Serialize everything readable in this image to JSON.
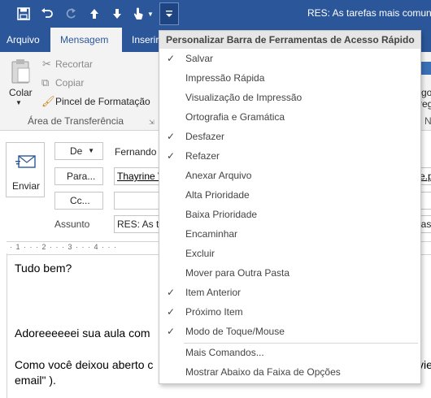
{
  "window": {
    "title": "RES: As tarefas mais comuns,"
  },
  "tabs": [
    "Arquivo",
    "Mensagem",
    "Inserir"
  ],
  "ribbon": {
    "paste_label": "Colar",
    "cut_label": "Recortar",
    "copy_label": "Copiar",
    "format_painter_label": "Pincel de Formatação",
    "clipboard_group_label": "Área de Transferência",
    "right_partial_1": "go",
    "right_partial_2": "reg",
    "right_partial_3": "N"
  },
  "compose": {
    "send_label": "Enviar",
    "from_button": "De",
    "from_value": "Fernando",
    "to_button": "Para...",
    "to_value": "Thayrine V",
    "to_value_right": "e.p",
    "cc_button": "Cc...",
    "subject_label": "Assunto",
    "subject_value": "RES: As ta",
    "subject_right": "las",
    "ruler": "· 1 · · · 2 · · · 3 · · · 4 · · ·",
    "body_lines": [
      "Tudo bem?",
      "Adoreeeeeei sua aula com",
      "Como você deixou aberto c",
      "email\" )."
    ],
    "body_right": "vie"
  },
  "menu": {
    "header": "Personalizar Barra de Ferramentas de Acesso Rápido",
    "items": [
      {
        "label": "Salvar",
        "checked": true
      },
      {
        "label": "Impressão Rápida",
        "checked": false
      },
      {
        "label": "Visualização de Impressão",
        "checked": false
      },
      {
        "label": "Ortografia e Gramática",
        "checked": false
      },
      {
        "label": "Desfazer",
        "checked": true
      },
      {
        "label": "Refazer",
        "checked": true
      },
      {
        "label": "Anexar Arquivo",
        "checked": false
      },
      {
        "label": "Alta Prioridade",
        "checked": false
      },
      {
        "label": "Baixa Prioridade",
        "checked": false
      },
      {
        "label": "Encaminhar",
        "checked": false
      },
      {
        "label": "Excluir",
        "checked": false
      },
      {
        "label": "Mover para Outra Pasta",
        "checked": false
      },
      {
        "label": "Item Anterior",
        "checked": true
      },
      {
        "label": "Próximo Item",
        "checked": true
      },
      {
        "label": "Modo de Toque/Mouse",
        "checked": true
      }
    ],
    "footer_items": [
      "Mais Comandos...",
      "Mostrar Abaixo da Faixa de Opções"
    ],
    "checkmark": "✓"
  },
  "colors": {
    "title_bar": "#2b579a",
    "ribbon_bg": "#f3f3f3",
    "menu_header_bg": "#e6e6e6"
  }
}
